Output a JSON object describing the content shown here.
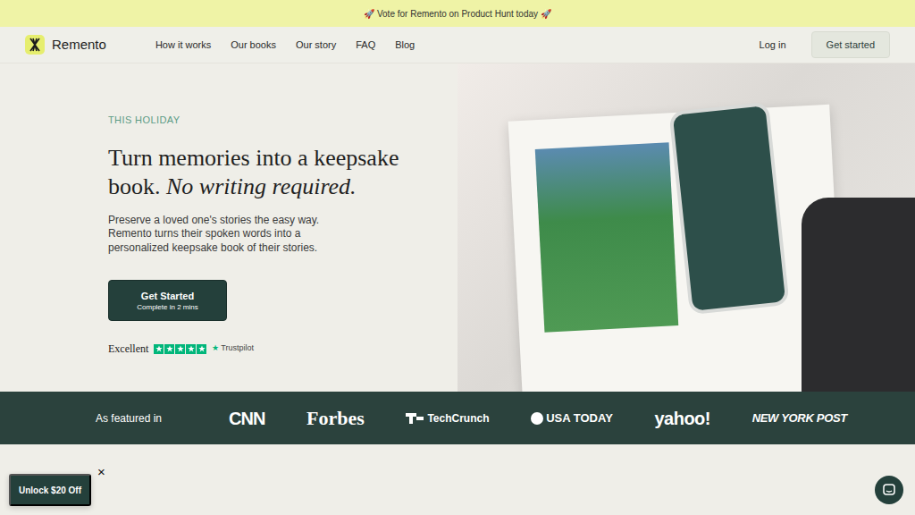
{
  "banner": {
    "text": "🚀 Vote for Remento on Product Hunt today 🚀"
  },
  "nav": {
    "brand": "Remento",
    "links": [
      "How it works",
      "Our books",
      "Our story",
      "FAQ",
      "Blog"
    ],
    "login": "Log in",
    "cta": "Get started"
  },
  "hero": {
    "eyebrow": "THIS HOLIDAY",
    "title": "Turn memories into a keepsake book.",
    "title_italic": "No writing required.",
    "body_lines": [
      "Preserve a loved one's stories the easy way.",
      "Remento turns their spoken words into a",
      "personalized keepsake book of their stories."
    ],
    "button": {
      "label": "Get Started",
      "sub": "Complete in 2 mins"
    },
    "rating": {
      "label": "Excellent",
      "stars": 5,
      "source_icon": "★",
      "source": "Trustpilot"
    }
  },
  "featured": {
    "label": "As featured in",
    "logos": [
      "CNN",
      "Forbes",
      "TechCrunch",
      "USA TODAY",
      "yahoo!",
      "NEW YORK POST"
    ]
  },
  "promo": {
    "label": "Unlock $20 Off",
    "close": "×"
  }
}
